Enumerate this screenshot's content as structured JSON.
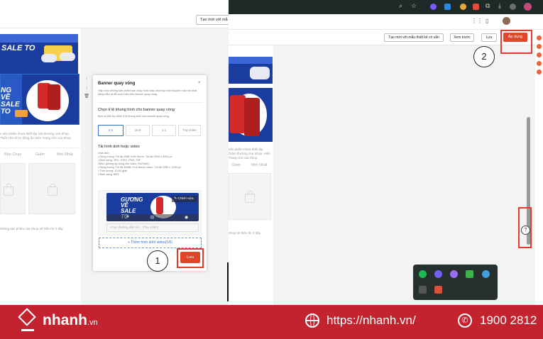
{
  "left": {
    "topbar_button": "Tạo mới với mẫ",
    "banner_text": "SALE TO",
    "banner2_text": "NG VỀ SALE TO",
    "hint_text": "n sản phẩm nhưa thiết lập Giả thường của Shop. Thiết nhà sẽ tự động ẩn Hiển Trang chủ của Shop.",
    "tabs": [
      "Bán Chạy",
      "Giảm",
      "Mới Nhất"
    ],
    "empty_text": "những sản phẩm của Shop sẽ hiển thị ở đây",
    "modal": {
      "title": "Banner quay vòng",
      "desc": "Hãy chọn những sản phẩm bán chạy nhất hoặc chương trình khuyến mãi mới nhất đăng diễn ra để cuốn hiện trên banner quay vòng.",
      "ratio_title": "Chọn tỉ lệ khung hình cho banner quay vòng",
      "ratio_desc": "Bạn có thể tùy chỉnh tỉ lệ khung hình của banner quay vòng.",
      "ratios": [
        "2:1",
        "16:9",
        "1:1",
        "Tùy chỉnh"
      ],
      "upload_title": "Tải hình ảnh hoặc video",
      "specs": [
        "Hình ảnh:",
        "• Dung lượng: Tối đa 2MB; Kích thước: Tối đa 2000 x 2000 px",
        "• Định dạng: JPG, JPEG, PNG, GIF",
        "Video (không áp dụng cho video YouTube):",
        "• Dung lượng: Tối đa 30MB; Kích thước video: Tối đa 1280 x 1280 px",
        "• Thời lượng: 10-60 giây",
        "• Định dạng: MP4"
      ],
      "edit_label": "Chỉnh sửa",
      "thumb_text": "GƯƠNG VỀ SALE TO",
      "url_placeholder": "Chọn đường dẫn tới... (Tùy chỉnh)",
      "add_media": "+ Thêm hình ảnh/ video(1/6)",
      "save": "Lưu"
    },
    "callout": "1"
  },
  "right": {
    "editor_buttons": {
      "create_template": "Tạo mới với mẫu thiết kế có sẵn",
      "preview": "Xem trước",
      "save": "Lưu",
      "apply": "Áp dụng"
    },
    "hint_text": "sản phẩm nhưa thiết lập Giảm thường của Shop. Hiển Trang chủ của Shop.",
    "tabs": [
      "Giảm",
      "Mới Nhất"
    ],
    "empty_text": "Shop sẽ hiển thị ở đây",
    "callout": "2",
    "help": "?"
  },
  "footer": {
    "brand": "nhanh",
    "brand_suffix": ".vn",
    "url": "https://nhanh.vn/",
    "phone": "1900 2812"
  },
  "colors": {
    "accent_red": "#e1462b",
    "footer_red": "#c3232f",
    "banner_blue": "#1b3c9f"
  }
}
